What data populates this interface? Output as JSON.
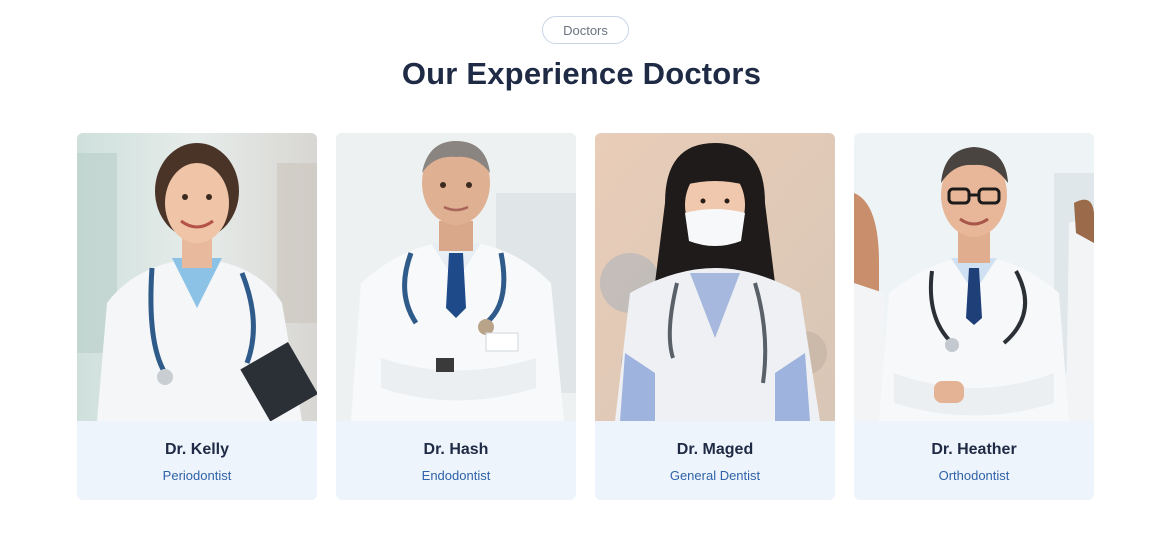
{
  "section": {
    "badge": "Doctors",
    "title": "Our Experience Doctors"
  },
  "doctors": [
    {
      "name": "Dr. Kelly",
      "role": "Periodontist"
    },
    {
      "name": "Dr. Hash",
      "role": "Endodontist"
    },
    {
      "name": "Dr. Maged",
      "role": "General Dentist"
    },
    {
      "name": "Dr. Heather",
      "role": "Orthodontist"
    }
  ],
  "colors": {
    "title": "#1f2a44",
    "role_text": "#2f62a8",
    "card_footer_bg": "#eef4fc",
    "badge_border": "#c9d4e6"
  }
}
